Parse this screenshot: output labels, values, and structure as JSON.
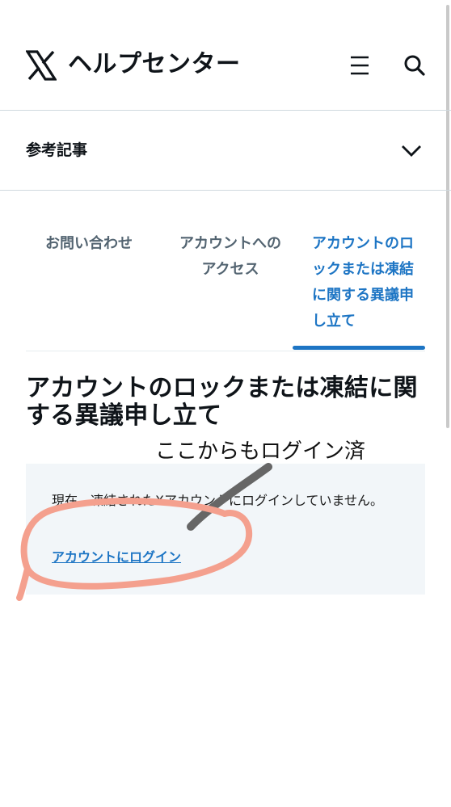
{
  "header": {
    "site_title": "ヘルプセンター",
    "logo_icon": "x-logo-icon",
    "menu_icon": "hamburger-menu-icon",
    "search_icon": "search-icon"
  },
  "related": {
    "label": "参考記事",
    "toggle_icon": "chevron-down-icon"
  },
  "tabs": [
    {
      "label": "お問い合わせ",
      "active": false
    },
    {
      "label": "アカウントへのアクセス",
      "active": false
    },
    {
      "label": "アカウントのロックまたは凍結に関する異議申し立て",
      "active": true
    }
  ],
  "article": {
    "title": "アカウントのロックまたは凍結に関する異議申し立て"
  },
  "notice": {
    "message": "現在、凍結されたXアカウントにログインしていません。",
    "link_label": "アカウントにログイン"
  },
  "annotation": {
    "handwritten_note": "ここからもログイン済"
  },
  "colors": {
    "accent": "#1d75c4",
    "notice_bg": "#f2f6f9",
    "circle_stroke": "#f4a08e",
    "arrow_stroke": "#666666"
  }
}
